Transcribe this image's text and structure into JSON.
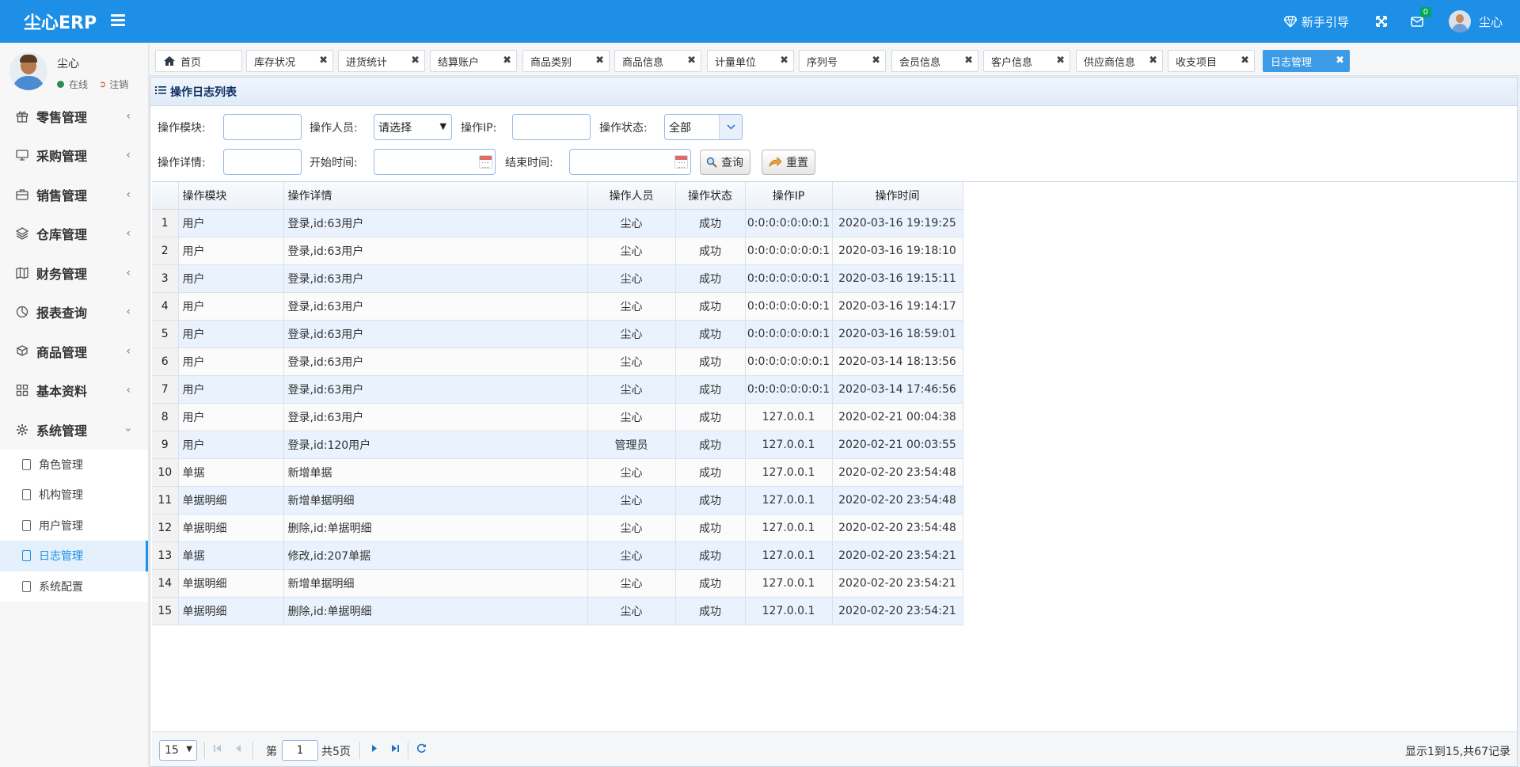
{
  "header": {
    "logo": "尘心ERP",
    "guide_label": "新手引导",
    "message_count": "0",
    "user_name": "尘心"
  },
  "sidebar": {
    "user": {
      "name": "尘心",
      "status": "在线",
      "logout": "注销"
    },
    "menu": [
      {
        "label": "零售管理",
        "icon": "gift-icon"
      },
      {
        "label": "采购管理",
        "icon": "monitor-icon"
      },
      {
        "label": "销售管理",
        "icon": "briefcase-icon"
      },
      {
        "label": "仓库管理",
        "icon": "layers-icon"
      },
      {
        "label": "财务管理",
        "icon": "map-icon"
      },
      {
        "label": "报表查询",
        "icon": "pie-chart-icon"
      },
      {
        "label": "商品管理",
        "icon": "cubes-icon"
      },
      {
        "label": "基本资料",
        "icon": "grid-icon"
      },
      {
        "label": "系统管理",
        "icon": "gear-icon"
      }
    ],
    "submenu": [
      "角色管理",
      "机构管理",
      "用户管理",
      "日志管理",
      "系统配置"
    ],
    "active_submenu": "日志管理"
  },
  "tabs": [
    "首页",
    "库存状况",
    "进货统计",
    "结算账户",
    "商品类别",
    "商品信息",
    "计量单位",
    "序列号",
    "会员信息",
    "客户信息",
    "供应商信息",
    "收支项目",
    "日志管理"
  ],
  "panel": {
    "title": "操作日志列表"
  },
  "search": {
    "module_label": "操作模块:",
    "operator_label": "操作人员:",
    "operator_value": "请选择",
    "ip_label": "操作IP:",
    "status_label": "操作状态:",
    "status_value": "全部",
    "detail_label": "操作详情:",
    "start_label": "开始时间:",
    "end_label": "结束时间:",
    "query_button": "查询",
    "reset_button": "重置"
  },
  "table": {
    "columns": [
      "操作模块",
      "操作详情",
      "操作人员",
      "操作状态",
      "操作IP",
      "操作时间"
    ],
    "rows": [
      [
        "1",
        "用户",
        "登录,id:63用户",
        "尘心",
        "成功",
        "0:0:0:0:0:0:0:1",
        "2020-03-16 19:19:25"
      ],
      [
        "2",
        "用户",
        "登录,id:63用户",
        "尘心",
        "成功",
        "0:0:0:0:0:0:0:1",
        "2020-03-16 19:18:10"
      ],
      [
        "3",
        "用户",
        "登录,id:63用户",
        "尘心",
        "成功",
        "0:0:0:0:0:0:0:1",
        "2020-03-16 19:15:11"
      ],
      [
        "4",
        "用户",
        "登录,id:63用户",
        "尘心",
        "成功",
        "0:0:0:0:0:0:0:1",
        "2020-03-16 19:14:17"
      ],
      [
        "5",
        "用户",
        "登录,id:63用户",
        "尘心",
        "成功",
        "0:0:0:0:0:0:0:1",
        "2020-03-16 18:59:01"
      ],
      [
        "6",
        "用户",
        "登录,id:63用户",
        "尘心",
        "成功",
        "0:0:0:0:0:0:0:1",
        "2020-03-14 18:13:56"
      ],
      [
        "7",
        "用户",
        "登录,id:63用户",
        "尘心",
        "成功",
        "0:0:0:0:0:0:0:1",
        "2020-03-14 17:46:56"
      ],
      [
        "8",
        "用户",
        "登录,id:63用户",
        "尘心",
        "成功",
        "127.0.0.1",
        "2020-02-21 00:04:38"
      ],
      [
        "9",
        "用户",
        "登录,id:120用户",
        "管理员",
        "成功",
        "127.0.0.1",
        "2020-02-21 00:03:55"
      ],
      [
        "10",
        "单据",
        "新增单据",
        "尘心",
        "成功",
        "127.0.0.1",
        "2020-02-20 23:54:48"
      ],
      [
        "11",
        "单据明细",
        "新增单据明细",
        "尘心",
        "成功",
        "127.0.0.1",
        "2020-02-20 23:54:48"
      ],
      [
        "12",
        "单据明细",
        "删除,id:单据明细",
        "尘心",
        "成功",
        "127.0.0.1",
        "2020-02-20 23:54:48"
      ],
      [
        "13",
        "单据",
        "修改,id:207单据",
        "尘心",
        "成功",
        "127.0.0.1",
        "2020-02-20 23:54:21"
      ],
      [
        "14",
        "单据明细",
        "新增单据明细",
        "尘心",
        "成功",
        "127.0.0.1",
        "2020-02-20 23:54:21"
      ],
      [
        "15",
        "单据明细",
        "删除,id:单据明细",
        "尘心",
        "成功",
        "127.0.0.1",
        "2020-02-20 23:54:21"
      ]
    ]
  },
  "pager": {
    "page_size": "15",
    "page_prefix": "第",
    "page_number": "1",
    "page_suffix": "共5页",
    "info": "显示1到15,共67记录"
  },
  "colors": {
    "primary": "#1e8fe6",
    "active_tab": "#3c9be6",
    "row_alt": "#e9f2fd"
  }
}
